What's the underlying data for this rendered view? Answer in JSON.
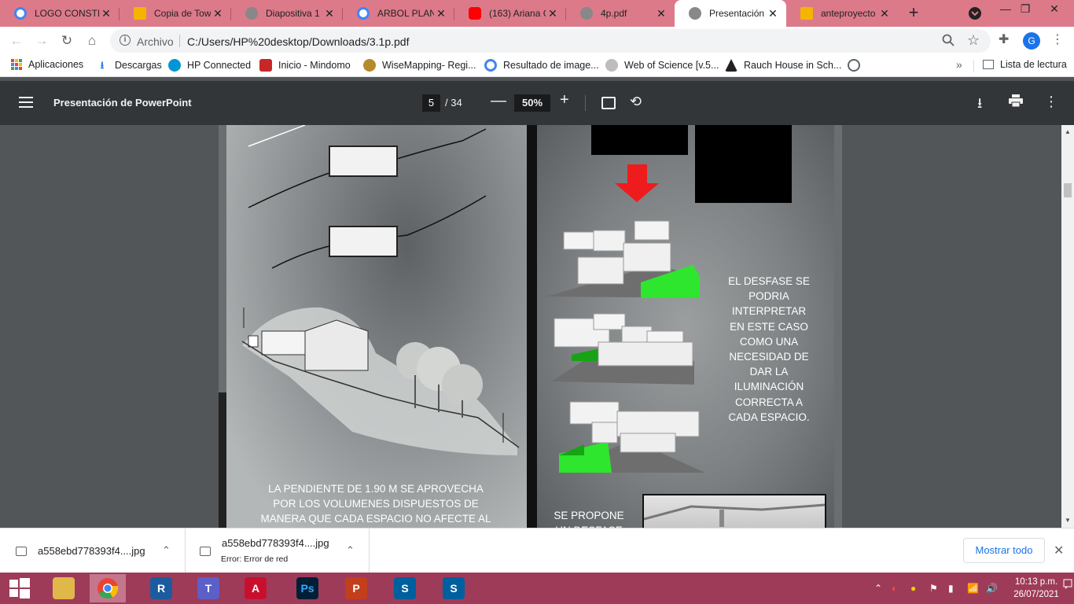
{
  "browser": {
    "tabs": [
      {
        "label": "LOGO CONSTR",
        "favicon_color": "#4285f4"
      },
      {
        "label": "Copia de Town",
        "favicon_color": "#f4b400"
      },
      {
        "label": "Diapositiva 1",
        "favicon_color": "#5f6368"
      },
      {
        "label": "ARBOL PLANT",
        "favicon_color": "#4285f4"
      },
      {
        "label": "(163) Ariana G",
        "favicon_color": "#ff0000"
      },
      {
        "label": "4p.pdf",
        "favicon_color": "#5f6368"
      },
      {
        "label": "Presentación d",
        "favicon_color": "#5f6368"
      },
      {
        "label": "anteproyecto",
        "favicon_color": "#f4b400"
      }
    ],
    "new_tab": "+",
    "address": {
      "scheme": "Archivo",
      "path": "C:/Users/HP%20desktop/Downloads/3.1p.pdf"
    },
    "avatar_letter": "G"
  },
  "bookmarks": {
    "items": [
      {
        "label": "Aplicaciones",
        "color": "#ea4335"
      },
      {
        "label": "Descargas",
        "color": "#1a73e8"
      },
      {
        "label": "HP Connected",
        "color": "#0096d6"
      },
      {
        "label": "Inicio - Mindomo",
        "color": "#c62828"
      },
      {
        "label": "WiseMapping- Regi...",
        "color": "#6d4c41"
      },
      {
        "label": "Resultado de image...",
        "color": "#4285f4"
      },
      {
        "label": "Web of Science [v.5...",
        "color": "#9e9e9e"
      },
      {
        "label": "Rauch House in Sch...",
        "color": "#212121"
      }
    ],
    "more": "»",
    "reading_list": "Lista de lectura"
  },
  "pdf": {
    "title": "Presentación de PowerPoint",
    "page_current": "5",
    "page_total": "/ 34",
    "zoom": "50%"
  },
  "slide": {
    "left_text": "LA PENDIENTE DE 1.90 m SE APROVECHA POR LOS VOLUMENES DISPUESTOS DE MANERA QUE CADA ESPACIO NO AFECTE AL TERRENO Y",
    "right_text": "EL DESFASE SE PODRIA INTERPRETAR EN ESTE CASO COMO UNA NECESIDAD DE DAR LA ILUMINACIÓN CORRECTA A CADA ESPACIO.",
    "bottom_text": "SE PROPONE UN DESFASE"
  },
  "downloads": {
    "items": [
      {
        "name": "a558ebd778393f4....jpg",
        "status": ""
      },
      {
        "name": "a558ebd778393f4....jpg",
        "status": "Error: Error de red"
      }
    ],
    "show_all": "Mostrar todo"
  },
  "taskbar": {
    "apps": [
      {
        "name": "file-explorer",
        "glyph": "",
        "color": "#e0b84a"
      },
      {
        "name": "chrome",
        "glyph": "",
        "color": "#34a853"
      },
      {
        "name": "revit",
        "glyph": "R",
        "color": "#1c5b9e"
      },
      {
        "name": "teams",
        "glyph": "T",
        "color": "#5b5fc7"
      },
      {
        "name": "autocad",
        "glyph": "A",
        "color": "#c8102e"
      },
      {
        "name": "photoshop",
        "glyph": "Ps",
        "color": "#001e36"
      },
      {
        "name": "powerpoint",
        "glyph": "P",
        "color": "#c43e1c"
      },
      {
        "name": "sketchup-1",
        "glyph": "S",
        "color": "#005f9e"
      },
      {
        "name": "sketchup-2",
        "glyph": "S",
        "color": "#005f9e"
      }
    ],
    "time": "10:13 p.m.",
    "date": "26/07/2021"
  }
}
